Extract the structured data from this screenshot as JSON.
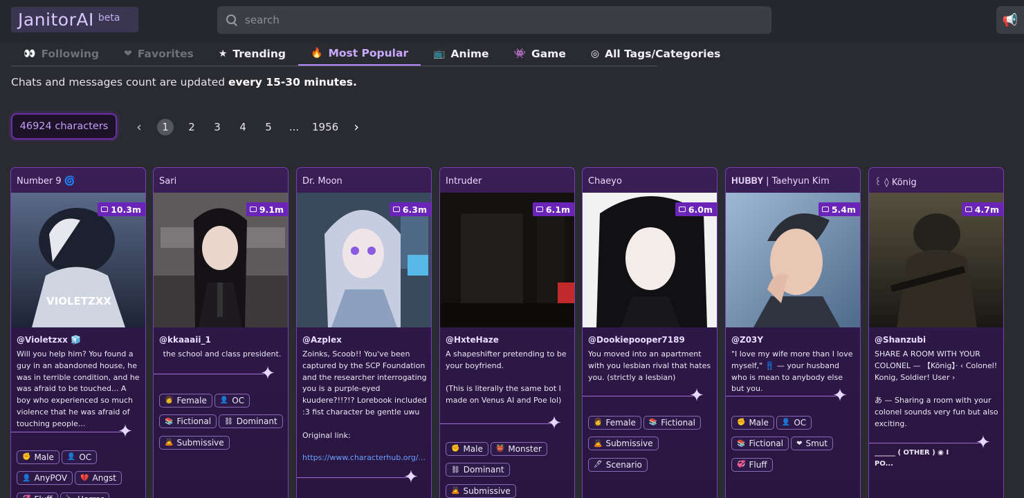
{
  "brand": {
    "name": "JanitorAI",
    "badge": "beta"
  },
  "search": {
    "placeholder": "search",
    "value": ""
  },
  "tabs": [
    {
      "label": "Following",
      "icon": "👀",
      "state": "dim"
    },
    {
      "label": "Favorites",
      "icon": "❤",
      "state": "dim"
    },
    {
      "label": "Trending",
      "icon": "★",
      "state": "normal"
    },
    {
      "label": "Most Popular",
      "icon": "🔥",
      "state": "active"
    },
    {
      "label": "Anime",
      "icon": "📺",
      "state": "normal"
    },
    {
      "label": "Game",
      "icon": "👾",
      "state": "normal"
    },
    {
      "label": "All Tags/Categories",
      "icon": "◎",
      "state": "normal"
    }
  ],
  "notice": {
    "prefix": "Chats and messages count are updated ",
    "bold": "every 15-30 minutes."
  },
  "character_count": "46924 characters",
  "pagination": {
    "prev": "‹",
    "pages": [
      "1",
      "2",
      "3",
      "4",
      "5",
      "...",
      "1956"
    ],
    "current": "1",
    "next": "›"
  },
  "colors": {
    "accent": "#b48cff",
    "card_border": "#7a3fb4",
    "stat_badge": "#6a25b8"
  },
  "cards": [
    {
      "name": "Number 9 🌀",
      "stat": "10.3m",
      "author": "@Violetzxx 🧊",
      "watermark": "VIOLETZXX",
      "description": "Will you help him? You found a guy in an abandoned house, he was in terrible condition, and he was afraid to be touched... A boy who experienced so much violence that he was afraid of touching people...",
      "tags": [
        [
          "✊",
          "Male"
        ],
        [
          "👤",
          "OC"
        ],
        [
          "👤",
          "AnyPOV"
        ],
        [
          "💔",
          "Angst"
        ],
        [
          "💞",
          "Fluff"
        ],
        [
          "🔪",
          "Horror"
        ]
      ]
    },
    {
      "name": "Sari",
      "stat": "9.1m",
      "author": "@kkaaaii_1",
      "description": "the school and class president.",
      "tags": [
        [
          "👩",
          "Female"
        ],
        [
          "👤",
          "OC"
        ],
        [
          "📚",
          "Fictional"
        ],
        [
          "⛓",
          "Dominant"
        ],
        [
          "🙇",
          "Submissive"
        ]
      ]
    },
    {
      "name": "Dr. Moon",
      "stat": "6.3m",
      "author": "@Azplex",
      "description": "Zoinks, Scoob!! You've been captured by the SCP Foundation and the researcher interrogating you is a purple-eyed kuudere?!!?!? Lorebook included :3 fist character be gentle uwu\n\nOriginal link:",
      "link": "https://www.characterhub.org/...",
      "tags": []
    },
    {
      "name": "Intruder",
      "stat": "6.1m",
      "author": "@HxteHaze",
      "description": "A shapeshifter pretending to be your boyfriend.\n\n(This is literally the same bot I made on Venus AI and Poe lol)",
      "tags": [
        [
          "✊",
          "Male"
        ],
        [
          "👹",
          "Monster"
        ],
        [
          "⛓",
          "Dominant"
        ],
        [
          "🙇",
          "Submissive"
        ]
      ]
    },
    {
      "name": "Chaeyo",
      "stat": "6.0m",
      "author": "@Dookiepooper7189",
      "description": "You moved into an apartment with you lesbian rival that hates you. (strictly a lesbian)",
      "tags": [
        [
          "👩",
          "Female"
        ],
        [
          "📚",
          "Fictional"
        ],
        [
          "🙇",
          "Submissive"
        ],
        [
          "🖊",
          "Scenario"
        ]
      ]
    },
    {
      "name": "𝐇𝐔𝐁𝐁𝐘 | Taehyun Kim",
      "stat": "5.4m",
      "author": "@Z03Y",
      "description": "\"I love my wife more than I love myself,\" 👖 — your husband who is mean to anybody else but you.",
      "tags": [
        [
          "✊",
          "Male"
        ],
        [
          "👤",
          "OC"
        ],
        [
          "📚",
          "Fictional"
        ],
        [
          "❤",
          "Smut"
        ],
        [
          "💞",
          "Fluff"
        ]
      ]
    },
    {
      "name": "꒰ ◊ König",
      "stat": "4.7m",
      "author": "@Shanzubi",
      "description": "SHARE A ROOM WITH YOUR COLONEL — 【König】· ‹ Colonel! Konig, Soldier! User ›\n\nあ — Sharing a room with your colonel sounds very fun but also exciting.",
      "footer_line": "______ ( OTHER ) ◉ I",
      "footer_more": "PO...",
      "tags": []
    }
  ]
}
